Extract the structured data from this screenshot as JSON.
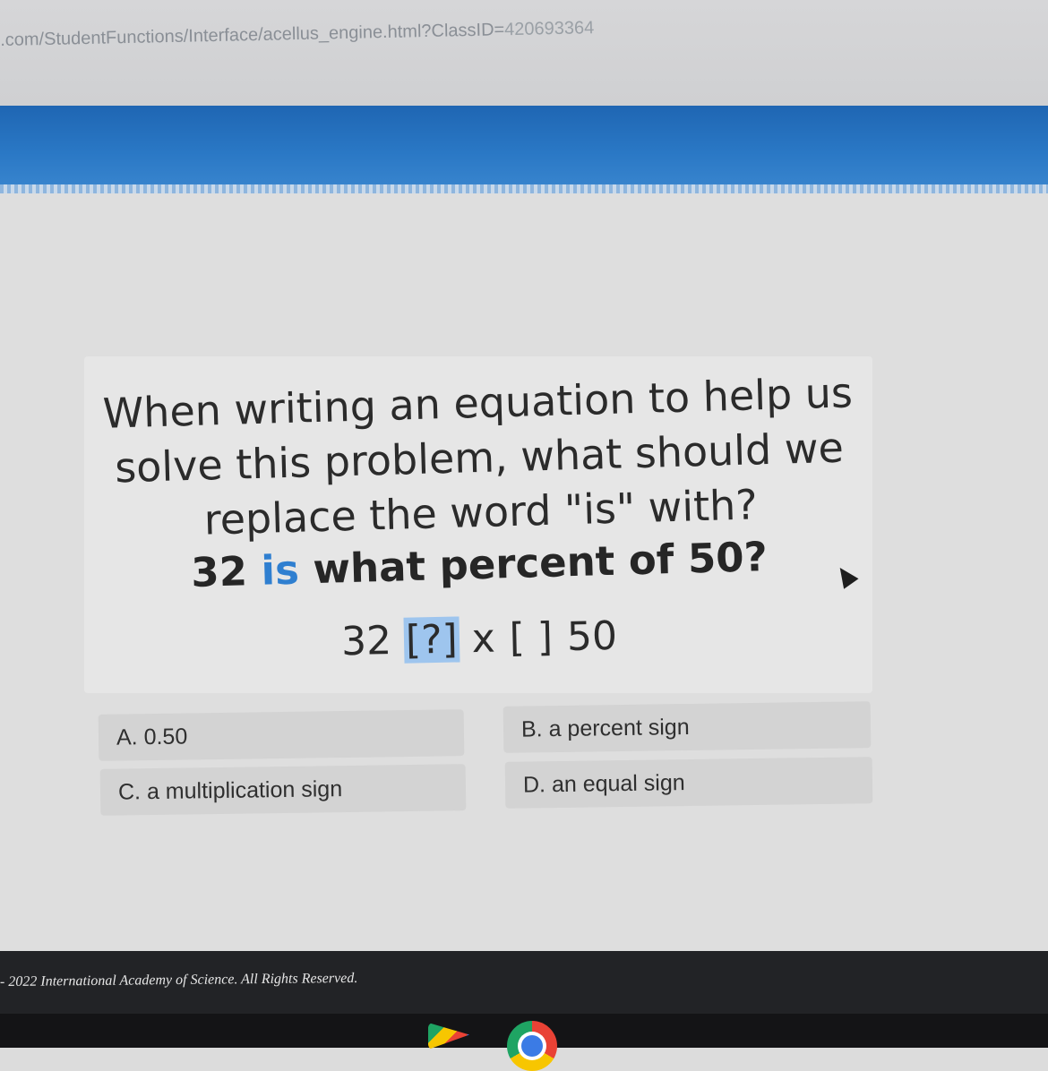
{
  "browser": {
    "url_prefix": ".com/StudentFunctions/Interface/acellus_engine.html?ClassID=",
    "url_id": "420693364"
  },
  "question": {
    "lines": [
      "When writing an equation to help us",
      "solve this problem, what should we",
      "replace the word \"is\" with?"
    ],
    "problem_before": "32 ",
    "problem_keyword": "is",
    "problem_after": " what percent of 50?",
    "equation": {
      "left": "32 ",
      "slot1": "[?]",
      "middle": " x ",
      "slot2": "[ ]",
      "right": " 50"
    }
  },
  "choices": [
    {
      "label": "A. 0.50"
    },
    {
      "label": "B. a percent sign"
    },
    {
      "label": "C. a multiplication sign"
    },
    {
      "label": "D. an equal sign"
    }
  ],
  "footer": {
    "copyright": "- 2022 International Academy of Science.  All Rights Reserved."
  },
  "colors": {
    "banner": "#2a78c5",
    "keyword": "#2f7fd0",
    "slot_highlight": "#9ec5ee"
  },
  "icons": [
    "cursor-arrow-icon",
    "google-play-icon",
    "chrome-icon"
  ]
}
